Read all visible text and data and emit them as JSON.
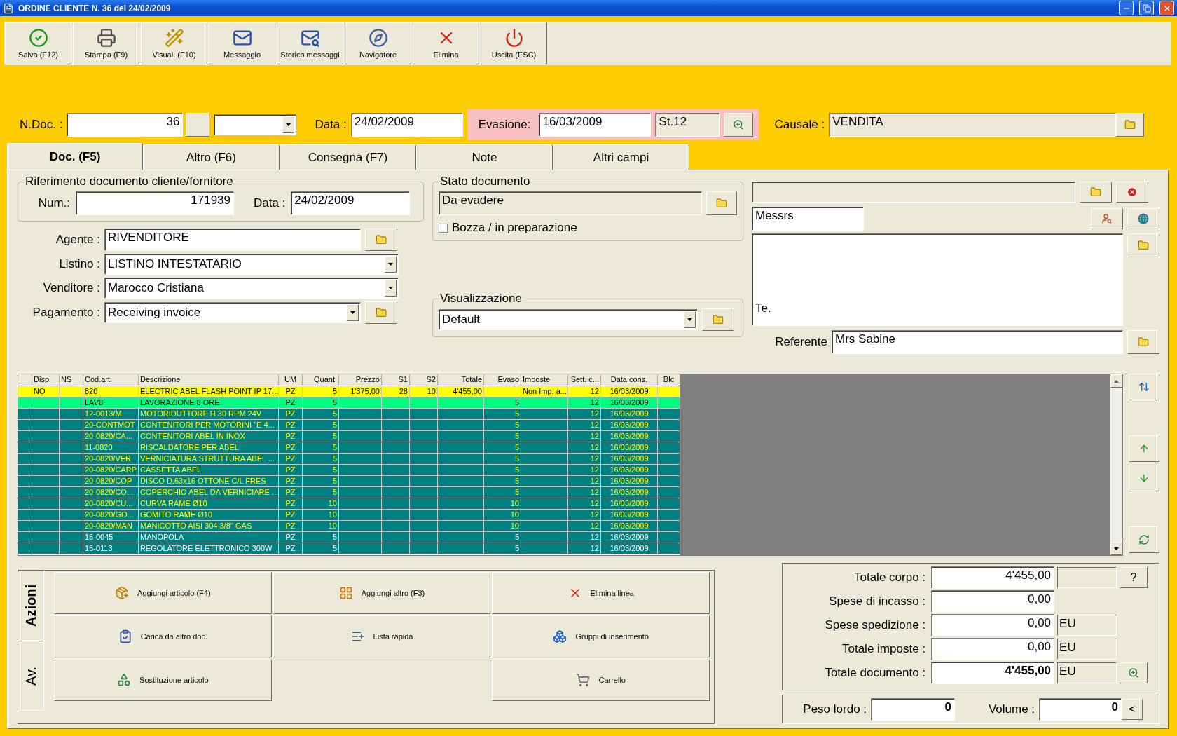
{
  "window": {
    "title": "ORDINE CLIENTE N. 36  del 24/02/2009"
  },
  "toolbar": [
    {
      "label": "Salva (F12)"
    },
    {
      "label": "Stampa (F9)"
    },
    {
      "label": "Visual. (F10)"
    },
    {
      "label": "Messaggio"
    },
    {
      "label": "Storico messaggi"
    },
    {
      "label": "Navigatore"
    },
    {
      "label": "Elimina"
    },
    {
      "label": "Uscita (ESC)"
    }
  ],
  "header": {
    "ndoc_label": "N.Doc. :",
    "ndoc": "36",
    "data_label": "Data :",
    "data": "24/02/2009",
    "evasione_label": "Evasione:",
    "evasione": "16/03/2009",
    "status": "St.12",
    "causale_label": "Causale :",
    "causale": "VENDITA"
  },
  "tabs": [
    {
      "label": "Doc. (F5)",
      "selected": true
    },
    {
      "label": "Altro (F6)",
      "selected": false
    },
    {
      "label": "Consegna (F7)",
      "selected": false
    },
    {
      "label": "Note",
      "selected": false
    },
    {
      "label": "Altri campi",
      "selected": false
    }
  ],
  "riferimento": {
    "title": "Riferimento documento cliente/fornitore",
    "num_label": "Num.:",
    "num": "171939",
    "data_label": "Data :",
    "data": "24/02/2009"
  },
  "fields": [
    {
      "kind": "lookup",
      "label": "Agente :",
      "value": "RIVENDITORE"
    },
    {
      "kind": "combo",
      "label": "Listino :",
      "value": "LISTINO INTESTATARIO"
    },
    {
      "kind": "combo",
      "label": "Venditore :",
      "value": "Marocco Cristiana"
    },
    {
      "kind": "combolookup",
      "label": "Pagamento :",
      "value": "Receiving invoice"
    }
  ],
  "stato": {
    "title": "Stato documento",
    "value": "Da evadere",
    "draft_label": "Bozza / in preparazione",
    "draft_checked": false
  },
  "visualizzazione": {
    "title": "Visualizzazione",
    "value": "Default"
  },
  "customer": {
    "salutation": "Messrs",
    "address": "Te.",
    "referente_label": "Referente",
    "referente": "Mrs Sabine"
  },
  "table": {
    "columns": [
      "Disp.",
      "NS",
      "Cod.art.",
      "Descrizione",
      "UM",
      "Quant.",
      "Prezzo",
      "S1",
      "S2",
      "Totale",
      "Evaso",
      "Imposte",
      "Sett. c...",
      "Data cons.",
      "Blc"
    ],
    "rows": [
      {
        "kind": "current",
        "cells": [
          "NO",
          null,
          "820",
          "ELECTRIC ABEL FLASH POINT IP 17...",
          "PZ",
          "5",
          "1'375,00",
          "28",
          "10",
          "4'455,00",
          null,
          "Non Imp. a...",
          "12",
          "16/03/2009",
          null
        ]
      },
      {
        "kind": "done",
        "cells": [
          null,
          null,
          "LAV8",
          "LAVORAZIONE 8 ORE",
          "PZ",
          "5",
          null,
          null,
          null,
          null,
          "5",
          null,
          "12",
          "16/03/2009",
          null
        ]
      },
      {
        "kind": "open",
        "cells": [
          null,
          null,
          "12-0013/M",
          "MOTORIDUTTORE H 30 RPM 24V",
          "PZ",
          "5",
          null,
          null,
          null,
          null,
          "5",
          null,
          "12",
          "16/03/2009",
          null
        ]
      },
      {
        "kind": "open",
        "cells": [
          null,
          null,
          "20-CONTMOT",
          "CONTENITORI PER MOTORINI \"E 4...",
          "PZ",
          "5",
          null,
          null,
          null,
          null,
          "5",
          null,
          "12",
          "16/03/2009",
          null
        ]
      },
      {
        "kind": "open",
        "cells": [
          null,
          null,
          "20-0820/CA...",
          "CONTENITORI ABEL IN INOX",
          "PZ",
          "5",
          null,
          null,
          null,
          null,
          "5",
          null,
          "12",
          "16/03/2009",
          null
        ]
      },
      {
        "kind": "open",
        "cells": [
          null,
          null,
          "11-0820",
          "RISCALDATORE PER ABEL",
          "PZ",
          "5",
          null,
          null,
          null,
          null,
          "5",
          null,
          "12",
          "16/03/2009",
          null
        ]
      },
      {
        "kind": "open",
        "cells": [
          null,
          null,
          "20-0820/VER",
          "VERNICIATURA STRUTTURA ABEL ...",
          "PZ",
          "5",
          null,
          null,
          null,
          null,
          "5",
          null,
          "12",
          "16/03/2009",
          null
        ]
      },
      {
        "kind": "open",
        "cells": [
          null,
          null,
          "20-0820/CARP",
          "CASSETTA ABEL",
          "PZ",
          "5",
          null,
          null,
          null,
          null,
          "5",
          null,
          "12",
          "16/03/2009",
          null
        ]
      },
      {
        "kind": "open",
        "cells": [
          null,
          null,
          "20-0820/COP",
          "DISCO D.63x16 OTTONE C/L FRES",
          "PZ",
          "5",
          null,
          null,
          null,
          null,
          "5",
          null,
          "12",
          "16/03/2009",
          null
        ]
      },
      {
        "kind": "open",
        "cells": [
          null,
          null,
          "20-0820/CO...",
          "COPERCHIO ABEL DA VERNICIARE ...",
          "PZ",
          "5",
          null,
          null,
          null,
          null,
          "5",
          null,
          "12",
          "16/03/2009",
          null
        ]
      },
      {
        "kind": "open",
        "cells": [
          null,
          null,
          "20-0820/CU...",
          "CURVA RAME Ø10",
          "PZ",
          "10",
          null,
          null,
          null,
          null,
          "10",
          null,
          "12",
          "16/03/2009",
          null
        ]
      },
      {
        "kind": "open",
        "cells": [
          null,
          null,
          "20-0820/GO...",
          "GOMITO RAME Ø10",
          "PZ",
          "10",
          null,
          null,
          null,
          null,
          "10",
          null,
          "12",
          "16/03/2009",
          null
        ]
      },
      {
        "kind": "open",
        "cells": [
          null,
          null,
          "20-0820/MAN",
          "MANICOTTO AISI 304 3/8'' GAS",
          "PZ",
          "10",
          null,
          null,
          null,
          null,
          "10",
          null,
          "12",
          "16/03/2009",
          null
        ]
      },
      {
        "kind": "plain",
        "cells": [
          null,
          null,
          "15-0045",
          "MANOPOLA",
          "PZ",
          "5",
          null,
          null,
          null,
          null,
          "5",
          null,
          "12",
          "16/03/2009",
          null
        ]
      },
      {
        "kind": "plain",
        "cells": [
          null,
          null,
          "15-0113",
          "REGOLATORE ELETTRONICO 300W",
          "PZ",
          "5",
          null,
          null,
          null,
          null,
          "5",
          null,
          "12",
          "16/03/2009",
          null
        ]
      }
    ]
  },
  "action_tabs": [
    {
      "label": "Azioni",
      "selected": true
    },
    {
      "label": "Av.",
      "selected": false
    }
  ],
  "actions": [
    {
      "label": "Aggiungi articolo (F4)"
    },
    {
      "label": "Aggiungi altro (F3)"
    },
    {
      "label": "Elimina linea"
    },
    {
      "label": "Carica da altro doc."
    },
    {
      "label": "Lista rapida"
    },
    {
      "label": "Gruppi di inserimento"
    },
    {
      "label": "Sostituzione articolo"
    },
    {
      "label": "Carrello"
    }
  ],
  "totals": [
    {
      "kind": "corpo",
      "label": "Totale corpo :",
      "value": "4'455,00",
      "button": "?"
    },
    {
      "kind": "plain",
      "label": "Spese di incasso :",
      "value": "0,00"
    },
    {
      "kind": "currency",
      "label": "Spese spedizione :",
      "value": "0,00",
      "unit": "EU"
    },
    {
      "kind": "currency",
      "label": "Totale imposte :",
      "value": "0,00",
      "unit": "EU"
    },
    {
      "kind": "total",
      "label": "Totale documento :",
      "value": "4'455,00",
      "unit": "EU"
    }
  ],
  "weights": [
    {
      "label": "Peso lordo :",
      "value": "0"
    },
    {
      "label": "Volume :",
      "value": "0"
    }
  ],
  "weights_button": "<"
}
